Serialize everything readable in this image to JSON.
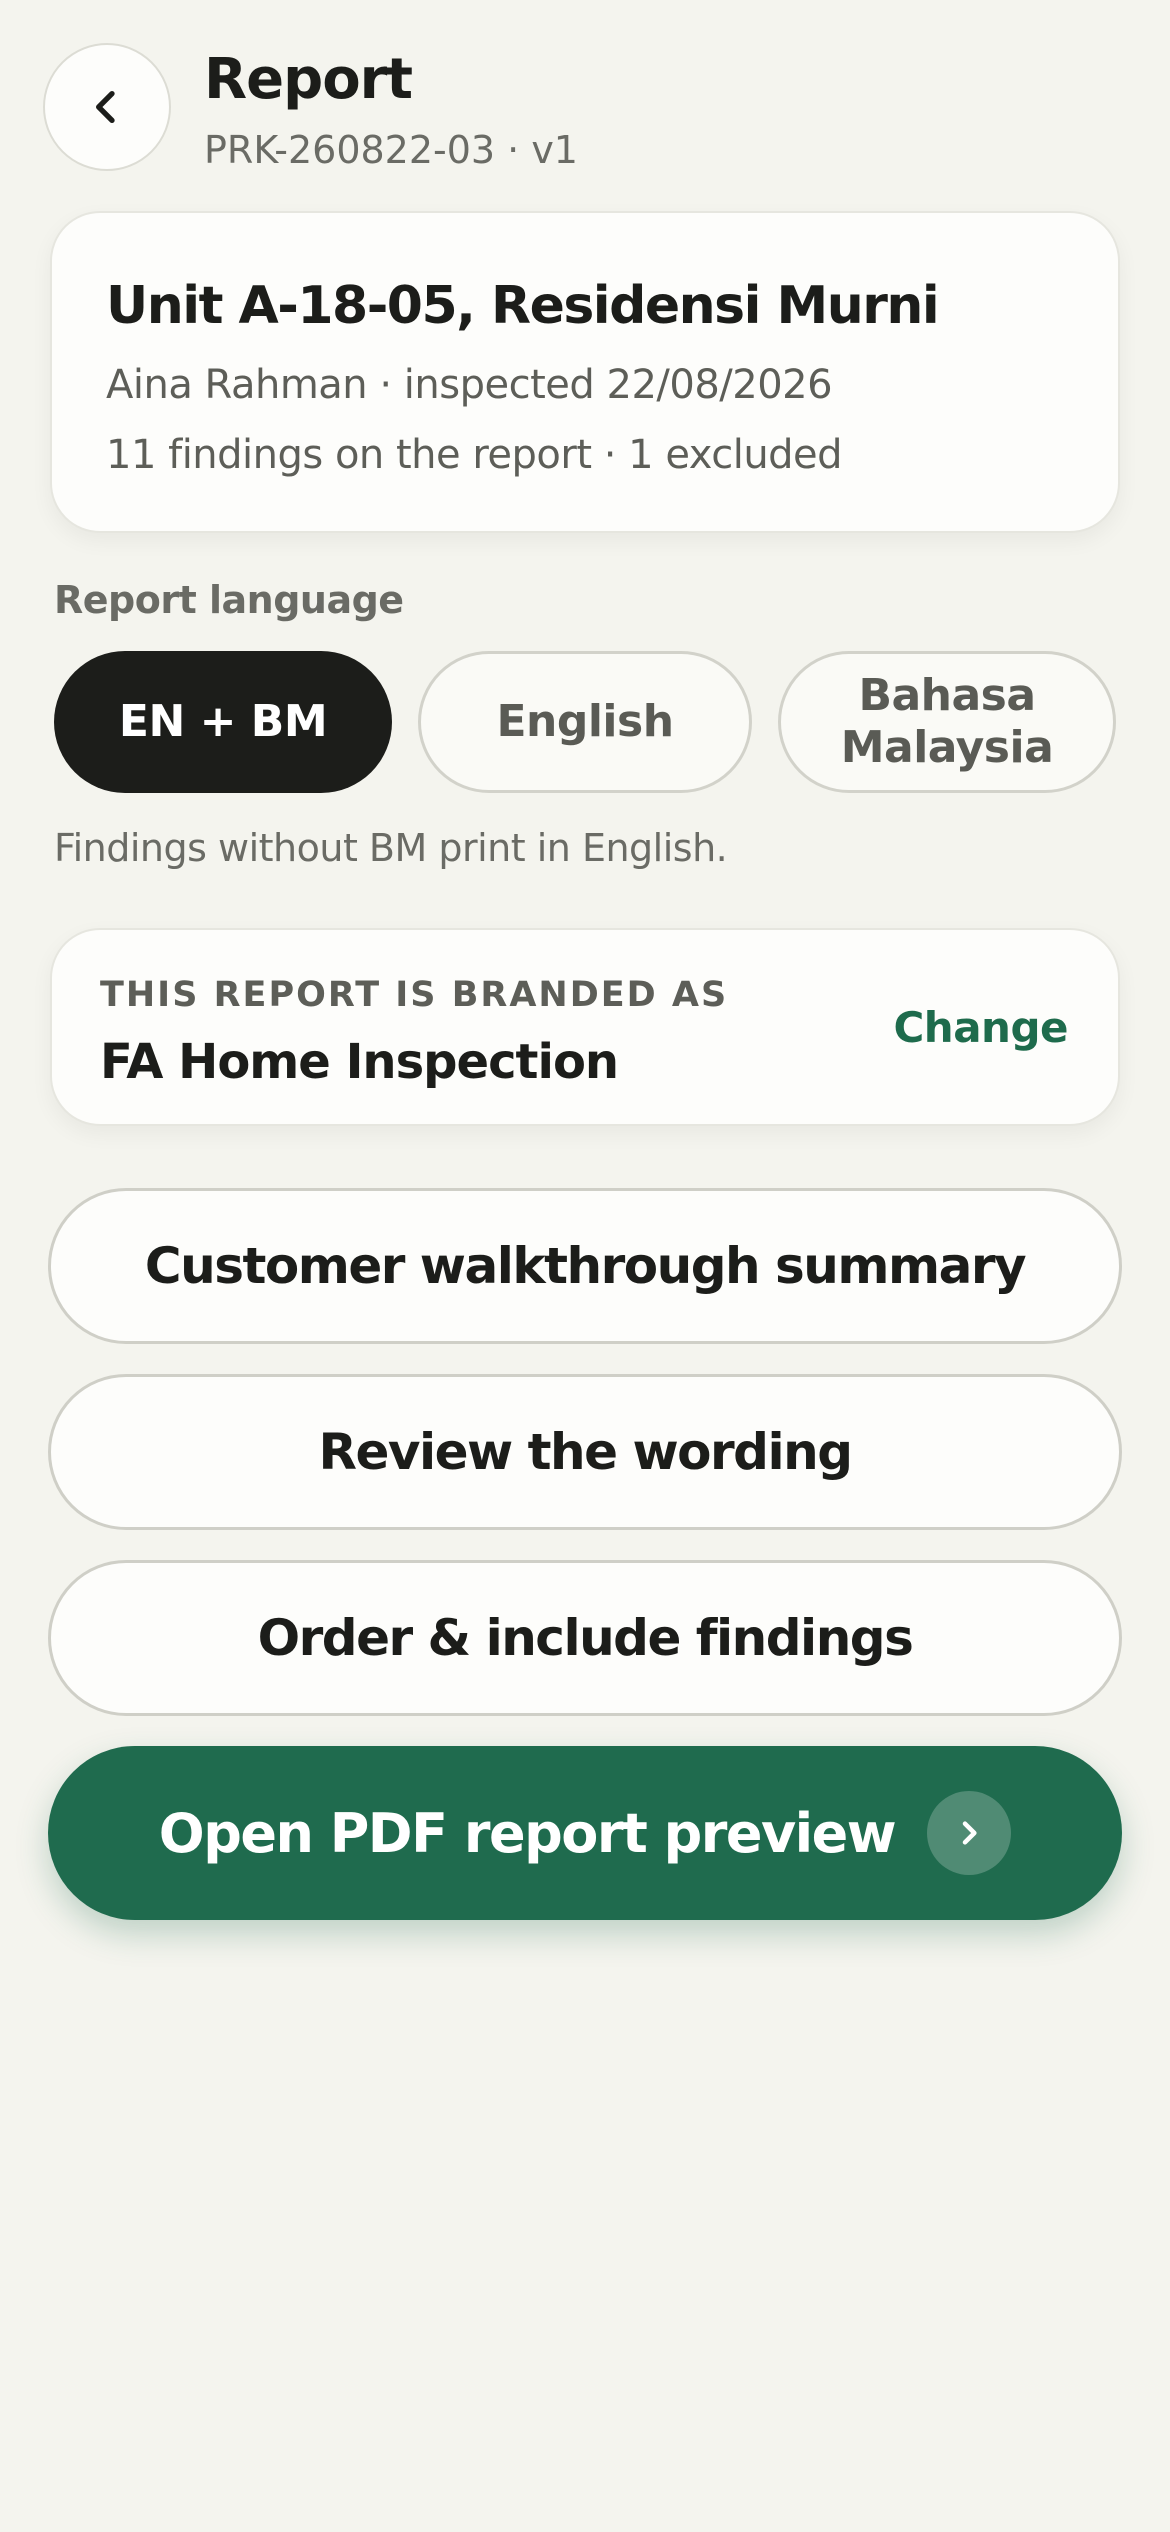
{
  "header": {
    "title": "Report",
    "subtitle": "PRK-260822-03 · v1",
    "back_icon": "chevron-left-icon"
  },
  "unit": {
    "title": "Unit A-18-05, Residensi Murni",
    "meta_line": "Aina Rahman · inspected 22/08/2026",
    "findings_line": "11 findings on the report · 1 excluded"
  },
  "language": {
    "label": "Report language",
    "options": [
      "EN + BM",
      "English",
      "Bahasa Malaysia"
    ],
    "selected": "EN + BM",
    "note": "Findings without BM print in English."
  },
  "branding": {
    "label": "THIS REPORT IS BRANDED AS",
    "name": "FA Home Inspection",
    "change_label": "Change"
  },
  "actions": {
    "walkthrough": "Customer walkthrough summary",
    "wording": "Review the wording",
    "order": "Order & include findings",
    "preview": "Open PDF report preview",
    "preview_icon": "chevron-right-icon"
  },
  "colors": {
    "background": "#f4f4ee",
    "accent": "#1f6b4e",
    "selected_pill": "#1c1d1a"
  }
}
